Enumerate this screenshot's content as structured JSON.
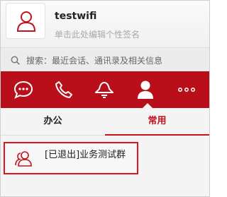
{
  "profile": {
    "username": "testwifi",
    "signature_placeholder": "单击此处编辑个性签名",
    "avatar_icon": "person-icon"
  },
  "search": {
    "placeholder": "搜索：最近会话、通讯录及相关信息",
    "icon": "search-icon"
  },
  "nav": {
    "background": "#b80f1a",
    "items": [
      {
        "icon": "chat-icon"
      },
      {
        "icon": "phone-icon"
      },
      {
        "icon": "broadcast-icon"
      },
      {
        "icon": "contacts-icon",
        "active": true
      },
      {
        "icon": "more-icon"
      }
    ]
  },
  "tabs": [
    {
      "label": "办公",
      "active": false
    },
    {
      "label": "常用",
      "active": true
    }
  ],
  "accent": "#c2131e",
  "list": {
    "items": [
      {
        "name": "[已退出]业务测试群",
        "icon": "group-icon",
        "highlighted": true
      }
    ]
  }
}
